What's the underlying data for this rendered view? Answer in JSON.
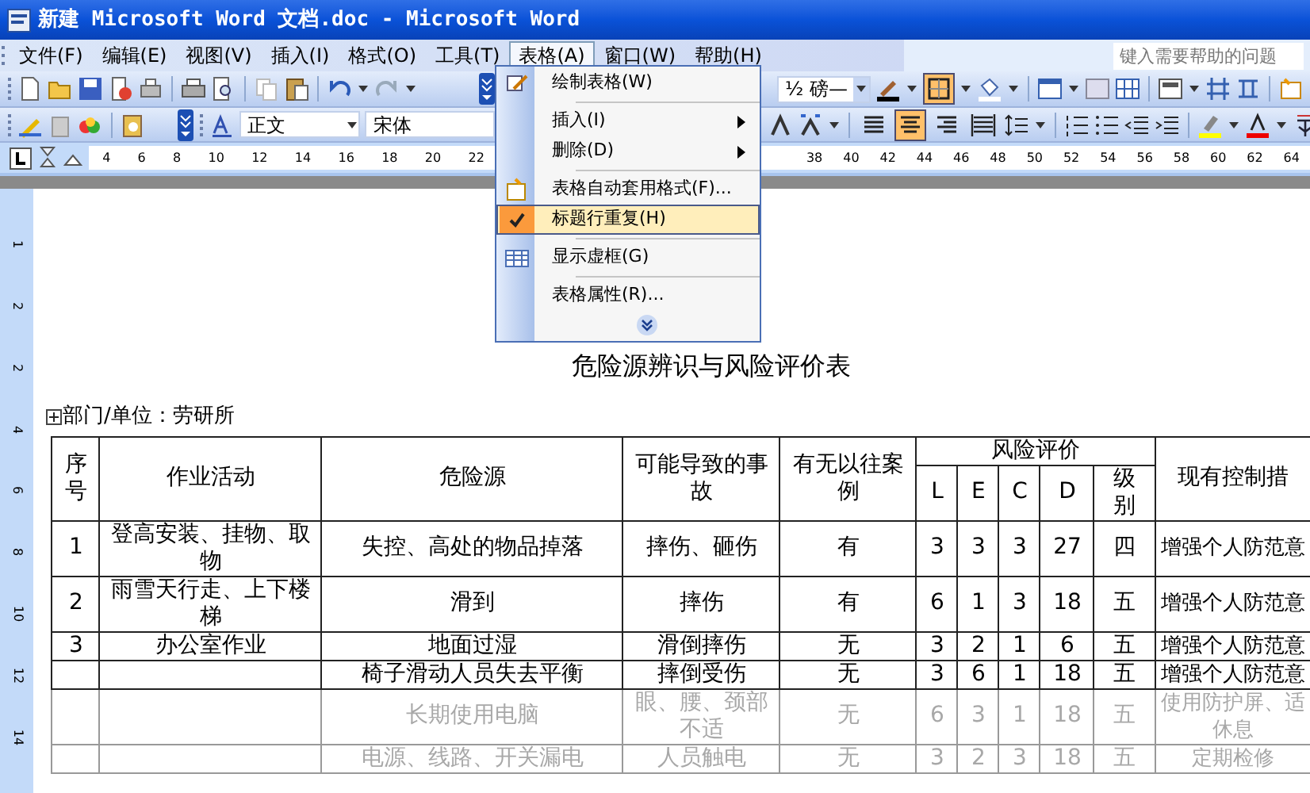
{
  "window": {
    "title": "新建 Microsoft Word 文档.doc - Microsoft Word"
  },
  "menu_bar": [
    {
      "label": "文件(F)",
      "selected": false
    },
    {
      "label": "编辑(E)",
      "selected": false
    },
    {
      "label": "视图(V)",
      "selected": false
    },
    {
      "label": "插入(I)",
      "selected": false
    },
    {
      "label": "格式(O)",
      "selected": false
    },
    {
      "label": "工具(T)",
      "selected": false
    },
    {
      "label": "表格(A)",
      "selected": true
    },
    {
      "label": "窗口(W)",
      "selected": false
    },
    {
      "label": "帮助(H)",
      "selected": false
    }
  ],
  "help_box": {
    "placeholder": "键入需要帮助的问题"
  },
  "table_toolbar": {
    "line_weight": "½ 磅—",
    "outside_border_on": true
  },
  "formatting_toolbar": {
    "style": "正文",
    "font": "宋体",
    "align_buttons": [
      {
        "selected": false
      },
      {
        "selected": true
      },
      {
        "selected": false
      },
      {
        "selected": false
      }
    ]
  },
  "ruler": {
    "left_numbers": [
      "4",
      "6",
      "8",
      "10",
      "12",
      "14",
      "16",
      "18",
      "20",
      "22"
    ],
    "right_numbers": [
      "38",
      "40",
      "42",
      "44",
      "46",
      "48",
      "50",
      "52",
      "54",
      "56",
      "58",
      "60",
      "62",
      "64"
    ]
  },
  "vertical_ruler": [
    "1",
    "2",
    "2",
    "4",
    "6",
    "8",
    "10",
    "12",
    "14"
  ],
  "table_menu": [
    {
      "label": "绘制表格(W)",
      "submenu": false,
      "checked": false,
      "selected": false
    },
    {
      "label": "插入(I)",
      "submenu": true,
      "checked": false,
      "selected": false
    },
    {
      "label": "删除(D)",
      "submenu": true,
      "checked": false,
      "selected": false
    },
    {
      "label": "表格自动套用格式(F)...",
      "submenu": false,
      "checked": false,
      "selected": false
    },
    {
      "label": "标题行重复(H)",
      "submenu": false,
      "checked": true,
      "selected": true
    },
    {
      "label": "显示虚框(G)",
      "submenu": false,
      "checked": false,
      "selected": false
    },
    {
      "label": "表格属性(R)...",
      "submenu": false,
      "checked": false,
      "selected": false
    }
  ],
  "document": {
    "title": "危险源辨识与风险评价表",
    "department": "部门/单位：劳研所",
    "table": {
      "columns": {
        "no": "序号",
        "activity": "作业活动",
        "hazard": "危险源",
        "accident": "可能导致的事故",
        "precedent": "有无以往案例",
        "risk": "风险评价",
        "l": "L",
        "e": "E",
        "c": "C",
        "d": "D",
        "level": "级别",
        "measure": "现有控制措"
      },
      "rows": [
        {
          "no": "1",
          "activity": "登高安装、挂物、取物",
          "hazard": "失控、高处的物品掉落",
          "accident": "摔伤、砸伤",
          "precedent": "有",
          "l": "3",
          "e": "3",
          "c": "3",
          "d": "27",
          "level": "四",
          "measure": "增强个人防范意",
          "faded": false
        },
        {
          "no": "2",
          "activity": "雨雪天行走、上下楼梯",
          "hazard": "滑到",
          "accident": "摔伤",
          "precedent": "有",
          "l": "6",
          "e": "1",
          "c": "3",
          "d": "18",
          "level": "五",
          "measure": "增强个人防范意",
          "faded": false
        },
        {
          "no": "3",
          "activity": "办公室作业",
          "hazard": "地面过湿",
          "accident": "滑倒摔伤",
          "precedent": "无",
          "l": "3",
          "e": "2",
          "c": "1",
          "d": "6",
          "level": "五",
          "measure": "增强个人防范意",
          "faded": false
        },
        {
          "hazard": "椅子滑动人员失去平衡",
          "accident": "摔倒受伤",
          "precedent": "无",
          "l": "3",
          "e": "6",
          "c": "1",
          "d": "18",
          "level": "五",
          "measure": "增强个人防范意",
          "faded": false
        },
        {
          "hazard": "长期使用电脑",
          "accident": "眼、腰、颈部不适",
          "precedent": "无",
          "l": "6",
          "e": "3",
          "c": "1",
          "d": "18",
          "level": "五",
          "measure": "使用防护屏、适休息",
          "faded": true
        },
        {
          "hazard": "电源、线路、开关漏电",
          "accident": "人员触电",
          "precedent": "无",
          "l": "3",
          "e": "2",
          "c": "3",
          "d": "18",
          "level": "五",
          "measure": "定期检修",
          "faded": true
        }
      ]
    }
  }
}
